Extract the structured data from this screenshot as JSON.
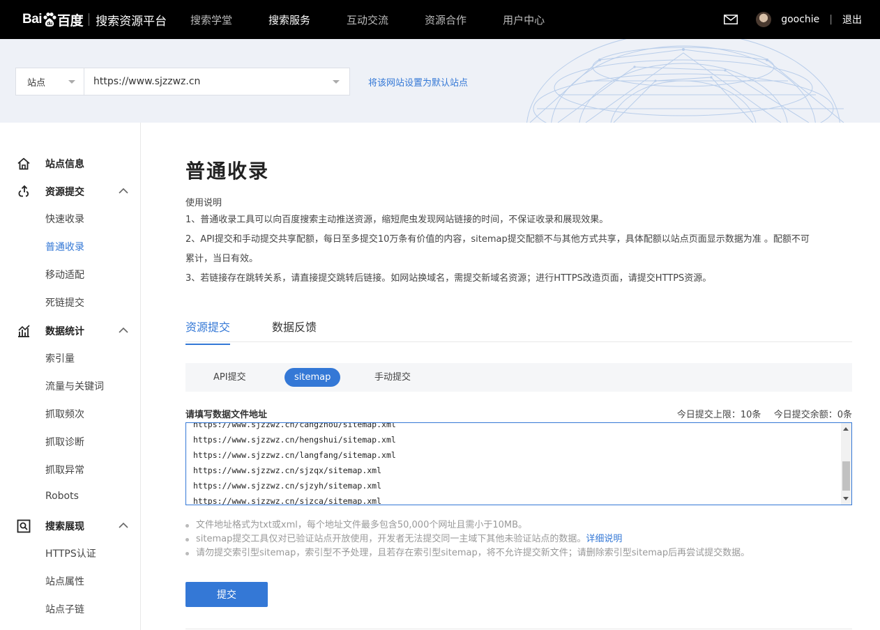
{
  "header": {
    "logo_text": "Bai",
    "logo_text2": "百度",
    "platform_name": "搜索资源平台",
    "nav": [
      {
        "label": "搜索学堂"
      },
      {
        "label": "搜索服务"
      },
      {
        "label": "互动交流"
      },
      {
        "label": "资源合作"
      },
      {
        "label": "用户中心"
      }
    ],
    "active_nav_index": 1,
    "username": "goochie",
    "divider": "|",
    "logout": "退出"
  },
  "site_bar": {
    "type_select": "站点",
    "site_url": "https://www.sjzzwz.cn",
    "set_default": "将该网站设置为默认站点"
  },
  "sidebar": {
    "groups": [
      {
        "label": "站点信息",
        "icon": "home-icon",
        "items": []
      },
      {
        "label": "资源提交",
        "icon": "submit-icon",
        "expanded": true,
        "items": [
          "快速收录",
          "普通收录",
          "移动适配",
          "死链提交"
        ]
      },
      {
        "label": "数据统计",
        "icon": "stats-icon",
        "expanded": true,
        "items": [
          "索引量",
          "流量与关键词",
          "抓取频次",
          "抓取诊断",
          "抓取异常",
          "Robots"
        ]
      },
      {
        "label": "搜索展现",
        "icon": "search-display-icon",
        "expanded": true,
        "items": [
          "HTTPS认证",
          "站点属性",
          "站点子链"
        ]
      }
    ],
    "active_item": "普通收录"
  },
  "main": {
    "title": "普通收录",
    "usage_title": "使用说明",
    "usage_lines": [
      "1、普通收录工具可以向百度搜索主动推送资源，缩短爬虫发现网站链接的时间，不保证收录和展现效果。",
      "2、API提交和手动提交共享配额，每日至多提交10万条有价值的内容，sitemap提交配额不与其他方式共享，具体配额以站点页面显示数据为准 。配额不可",
      "累计，当日有效。",
      "3、若链接存在跳转关系，请直接提交跳转后链接。如网站换域名，需提交新域名资源；进行HTTPS改造页面，请提交HTTPS资源。"
    ],
    "tabs": [
      "资源提交",
      "数据反馈"
    ],
    "active_tab": 0,
    "subtabs": [
      "API提交",
      "sitemap",
      "手动提交"
    ],
    "active_subtab": 1,
    "form_label": "请填写数据文件地址",
    "quota_limit": "今日提交上限：10条",
    "quota_left": "今日提交余额：0条",
    "textarea_lines": [
      "https://www.sjzzwz.cn/cangzhou/sitemap.xml",
      "https://www.sjzzwz.cn/hengshui/sitemap.xml",
      "https://www.sjzzwz.cn/langfang/sitemap.xml",
      "https://www.sjzzwz.cn/sjzqx/sitemap.xml",
      "https://www.sjzzwz.cn/sjzyh/sitemap.xml",
      "https://www.sjzzwz.cn/sjzca/sitemap.xml"
    ],
    "notes": [
      "文件地址格式为txt或xml，每个地址文件最多包含50,000个网址且需小于10MB。",
      "sitemap提交工具仅对已验证站点开放使用，开发者无法提交同一主域下其他未验证站点的数据。",
      "请勿提交索引型sitemap，索引型不予处理，且若存在索引型sitemap，将不允许提交新文件；请删除索引型sitemap后再尝试提交数据。"
    ],
    "note_link": "详细说明",
    "submit": "提交"
  },
  "colors": {
    "accent": "#3478d6",
    "topbar": "#000000",
    "sitebar_bg": "#eef1f7"
  }
}
